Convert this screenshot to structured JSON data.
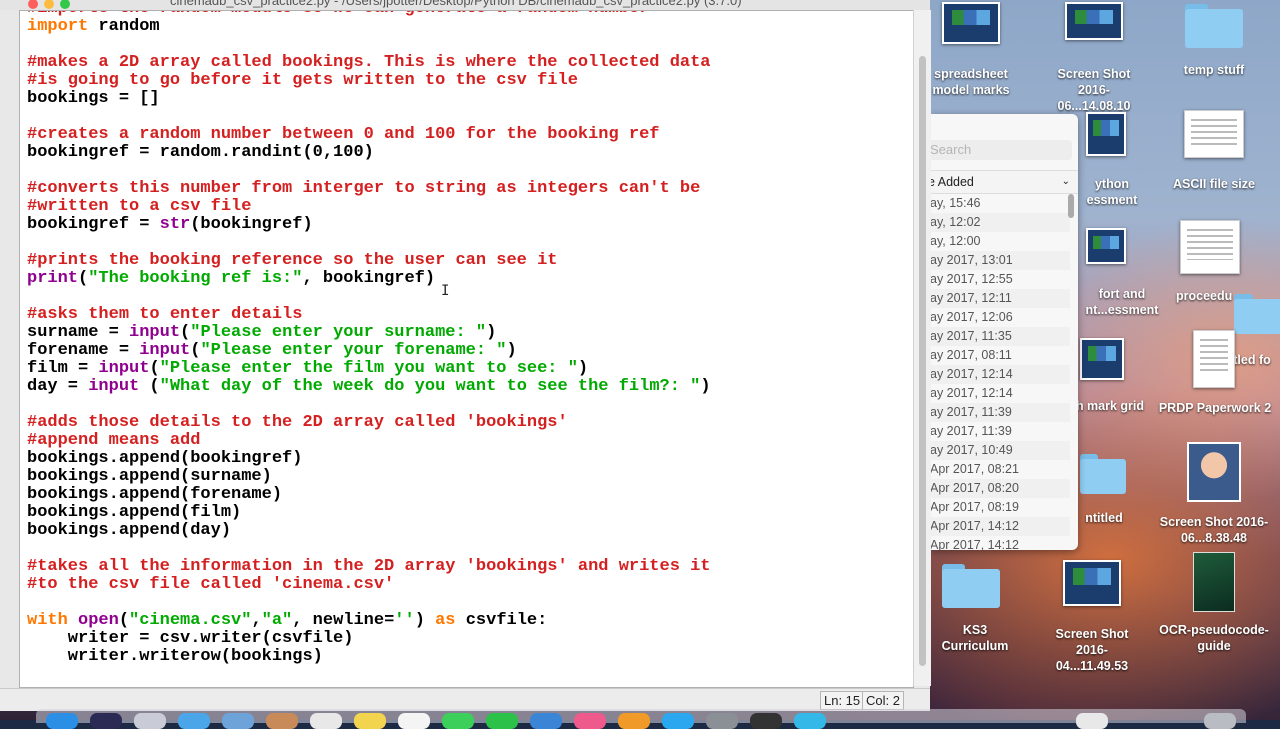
{
  "window": {
    "title": "cinemadb_csv_practice2.py - /Users/jpotter/Desktop/Python DB/cinemadb_csv_practice2.py (3.7.0)"
  },
  "editor": {
    "status": {
      "line": "Ln: 15",
      "col": "Col: 2"
    }
  },
  "desktop": {
    "icons": [
      {
        "label": "spreadsheet model marks"
      },
      {
        "label": "Screen Shot 2016-06...14.08.10"
      },
      {
        "label": "temp stuff"
      },
      {
        "label": "ython essment"
      },
      {
        "label": "ASCII file size"
      },
      {
        "label": "fort and nt...essment"
      },
      {
        "label": "proceedu"
      },
      {
        "label": "ntitled fo"
      },
      {
        "label": "h mark grid"
      },
      {
        "label": "PRDP Paperwork 2"
      },
      {
        "label": "ntitled"
      },
      {
        "label": "Screen Shot 2016-06...8.38.48"
      },
      {
        "label": "KS3 Curriculum"
      },
      {
        "label": "Screen Shot 2016-04...11.49.53"
      },
      {
        "label": "OCR-pseudocode-guide"
      }
    ]
  },
  "finder": {
    "search_placeholder": "Search",
    "sort_label": "e Added",
    "rows": [
      "ay, 15:46",
      "ay, 12:02",
      "ay, 12:00",
      "ay 2017, 13:01",
      "ay 2017, 12:55",
      "ay 2017, 12:11",
      "ay 2017, 12:06",
      "ay 2017, 11:35",
      "ay 2017, 08:11",
      "ay 2017, 12:14",
      "ay 2017, 12:14",
      "ay 2017, 11:39",
      "ay 2017, 11:39",
      "ay 2017, 10:49",
      "Apr 2017, 08:21",
      "Apr 2017, 08:20",
      "Apr 2017, 08:19",
      "Apr 2017, 14:12",
      "Apr 2017, 14:12"
    ]
  },
  "code_lines": [
    [
      [
        "cm",
        "#imports the random module so we can generate a random number"
      ]
    ],
    [
      [
        "kw",
        "import"
      ],
      [
        "",
        " random"
      ]
    ],
    [
      [
        "",
        ""
      ]
    ],
    [
      [
        "cm",
        "#makes a 2D array called bookings. This is where the collected data"
      ]
    ],
    [
      [
        "cm",
        "#is going to go before it gets written to the csv file"
      ]
    ],
    [
      [
        "",
        "bookings = []"
      ]
    ],
    [
      [
        "",
        ""
      ]
    ],
    [
      [
        "cm",
        "#creates a random number between 0 and 100 for the booking ref"
      ]
    ],
    [
      [
        "",
        "bookingref = random.randint(0,100)"
      ]
    ],
    [
      [
        "",
        ""
      ]
    ],
    [
      [
        "cm",
        "#converts this number from interger to string as integers can't be"
      ]
    ],
    [
      [
        "cm",
        "#written to a csv file"
      ]
    ],
    [
      [
        "",
        "bookingref = "
      ],
      [
        "bi",
        "str"
      ],
      [
        "",
        "(bookingref)"
      ]
    ],
    [
      [
        "",
        ""
      ]
    ],
    [
      [
        "cm",
        "#prints the booking reference so the user can see it"
      ]
    ],
    [
      [
        "bi",
        "print"
      ],
      [
        "",
        "("
      ],
      [
        "st",
        "\"The booking ref is:\""
      ],
      [
        "",
        ", bookingref)"
      ]
    ],
    [
      [
        "",
        ""
      ]
    ],
    [
      [
        "cm",
        "#asks them to enter details"
      ]
    ],
    [
      [
        "",
        "surname = "
      ],
      [
        "bi",
        "input"
      ],
      [
        "",
        "("
      ],
      [
        "st",
        "\"Please enter your surname: \""
      ],
      [
        "",
        ")"
      ]
    ],
    [
      [
        "",
        "forename = "
      ],
      [
        "bi",
        "input"
      ],
      [
        "",
        "("
      ],
      [
        "st",
        "\"Please enter your forename: \""
      ],
      [
        "",
        ")"
      ]
    ],
    [
      [
        "",
        "film = "
      ],
      [
        "bi",
        "input"
      ],
      [
        "",
        "("
      ],
      [
        "st",
        "\"Please enter the film you want to see: \""
      ],
      [
        "",
        ")"
      ]
    ],
    [
      [
        "",
        "day = "
      ],
      [
        "bi",
        "input"
      ],
      [
        "",
        " ("
      ],
      [
        "st",
        "\"What day of the week do you want to see the film?: \""
      ],
      [
        "",
        ")"
      ]
    ],
    [
      [
        "",
        ""
      ]
    ],
    [
      [
        "cm",
        "#adds those details to the 2D array called 'bookings'"
      ]
    ],
    [
      [
        "cm",
        "#append means add"
      ]
    ],
    [
      [
        "",
        "bookings.append(bookingref)"
      ]
    ],
    [
      [
        "",
        "bookings.append(surname)"
      ]
    ],
    [
      [
        "",
        "bookings.append(forename)"
      ]
    ],
    [
      [
        "",
        "bookings.append(film)"
      ]
    ],
    [
      [
        "",
        "bookings.append(day)"
      ]
    ],
    [
      [
        "",
        ""
      ]
    ],
    [
      [
        "cm",
        "#takes all the information in the 2D array 'bookings' and writes it"
      ]
    ],
    [
      [
        "cm",
        "#to the csv file called 'cinema.csv'"
      ]
    ],
    [
      [
        "",
        ""
      ]
    ],
    [
      [
        "kw",
        "with"
      ],
      [
        "",
        " "
      ],
      [
        "bi",
        "open"
      ],
      [
        "",
        "("
      ],
      [
        "st",
        "\"cinema.csv\""
      ],
      [
        "",
        ","
      ],
      [
        "st",
        "\"a\""
      ],
      [
        "",
        ", newline="
      ],
      [
        "st",
        "''"
      ],
      [
        "",
        ") "
      ],
      [
        "kw",
        "as"
      ],
      [
        "",
        " csvfile:"
      ]
    ],
    [
      [
        "",
        "    writer = csv.writer(csvfile)"
      ]
    ],
    [
      [
        "",
        "    writer.writerow(bookings)"
      ]
    ]
  ],
  "colors": {
    "comment": "#d42020",
    "keyword": "#ff7700",
    "builtin": "#900090",
    "string": "#00aa00"
  }
}
